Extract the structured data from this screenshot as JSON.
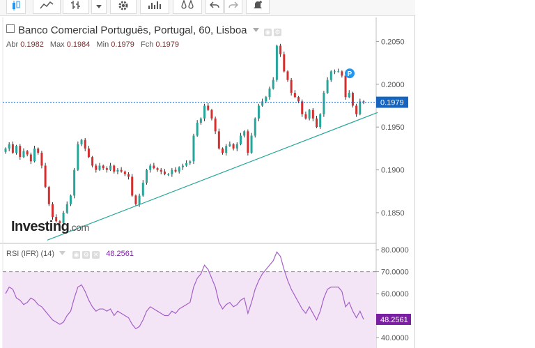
{
  "toolbar": {
    "icons": [
      "candlestick-icon",
      "line-chart-icon",
      "bars-icon",
      "dropdown-caret-icon",
      "gear-icon",
      "indicators-icon",
      "alerts-icon",
      "undo-icon",
      "redo-icon",
      "add-alert-icon"
    ]
  },
  "legend": {
    "title": "Banco Comercial Português, Portugal, 60, Lisboa",
    "open_label": "Abr",
    "open_value": "0.1982",
    "high_label": "Max",
    "high_value": "0.1984",
    "low_label": "Min",
    "low_value": "0.1979",
    "close_label": "Fch",
    "close_value": "0.1979"
  },
  "rsi_legend": {
    "title": "RSI (IFR) (14)",
    "value": "48.2561"
  },
  "logo": {
    "text": "Investing",
    "suffix": ".com"
  },
  "marker": {
    "label": "P"
  },
  "colors": {
    "up": "#26a69a",
    "down": "#d32f2f",
    "wick": "#333333",
    "trendline": "#26a69a",
    "price_line": "#1565c0",
    "price_tag": "#1565c0",
    "rsi": "#a35fc9",
    "rsi_tag": "#7b1fa2",
    "rsi_band": "#f3e5f5"
  },
  "chart_data": [
    {
      "type": "candlestick",
      "title": "Banco Comercial Português, Portugal, 60, Lisboa",
      "ylim": [
        0.1815,
        0.2078
      ],
      "y_ticks": [
        "0.2050",
        "0.2000",
        "0.1950",
        "0.1900",
        "0.1850"
      ],
      "last_price": 0.1979,
      "last_price_label": "0.1979",
      "close": [
        0.1925,
        0.193,
        0.192,
        0.1928,
        0.1915,
        0.1922,
        0.1918,
        0.191,
        0.1925,
        0.192,
        0.1905,
        0.188,
        0.186,
        0.1845,
        0.184,
        0.1838,
        0.185,
        0.186,
        0.187,
        0.19,
        0.193,
        0.1935,
        0.1925,
        0.1915,
        0.1905,
        0.19,
        0.1905,
        0.1902,
        0.19,
        0.1905,
        0.1898,
        0.19,
        0.1898,
        0.1895,
        0.1892,
        0.187,
        0.186,
        0.187,
        0.1885,
        0.19,
        0.1905,
        0.1902,
        0.19,
        0.1898,
        0.1895,
        0.1895,
        0.19,
        0.1898,
        0.1903,
        0.1905,
        0.1908,
        0.191,
        0.194,
        0.1955,
        0.196,
        0.1975,
        0.197,
        0.196,
        0.1945,
        0.1925,
        0.192,
        0.1928,
        0.193,
        0.1925,
        0.193,
        0.194,
        0.1945,
        0.192,
        0.194,
        0.196,
        0.1975,
        0.198,
        0.1985,
        0.1995,
        0.2005,
        0.2045,
        0.2035,
        0.2015,
        0.2005,
        0.199,
        0.1985,
        0.198,
        0.1965,
        0.196,
        0.197,
        0.196,
        0.195,
        0.1965,
        0.199,
        0.2005,
        0.2015,
        0.2015,
        0.2015,
        0.201,
        0.1985,
        0.199,
        0.1975,
        0.1965,
        0.198,
        0.1979
      ],
      "trendline": [
        [
          0,
          0.1818
        ],
        [
          99,
          0.1967
        ]
      ],
      "marker_index": 94
    },
    {
      "type": "line",
      "title": "RSI (IFR) (14)",
      "ylim": [
        35.2,
        82.6
      ],
      "y_ticks": [
        "80.0000",
        "70.0000",
        "60.0000",
        "40.0000"
      ],
      "band": [
        30,
        70
      ],
      "last_value": 48.2561,
      "last_value_label": "48.2561",
      "values": [
        60,
        63,
        62,
        58,
        57,
        55,
        56,
        58,
        57,
        55,
        54,
        52,
        50,
        48,
        47,
        46,
        47,
        50,
        52,
        58,
        63,
        64,
        61,
        57,
        54,
        52,
        53,
        53,
        52,
        53,
        50,
        52,
        51,
        50,
        49,
        46,
        44,
        45,
        48,
        52,
        54,
        53,
        52,
        51,
        50,
        50,
        52,
        51,
        53,
        54,
        55,
        56,
        63,
        67,
        69,
        73,
        71,
        67,
        63,
        56,
        53,
        55,
        56,
        54,
        55,
        57,
        58,
        51,
        56,
        62,
        66,
        69,
        71,
        73,
        75,
        79,
        77,
        71,
        66,
        62,
        59,
        56,
        53,
        51,
        54,
        51,
        48,
        52,
        58,
        62,
        63,
        63,
        63,
        61,
        54,
        56,
        52,
        49,
        52,
        48.26
      ]
    }
  ]
}
